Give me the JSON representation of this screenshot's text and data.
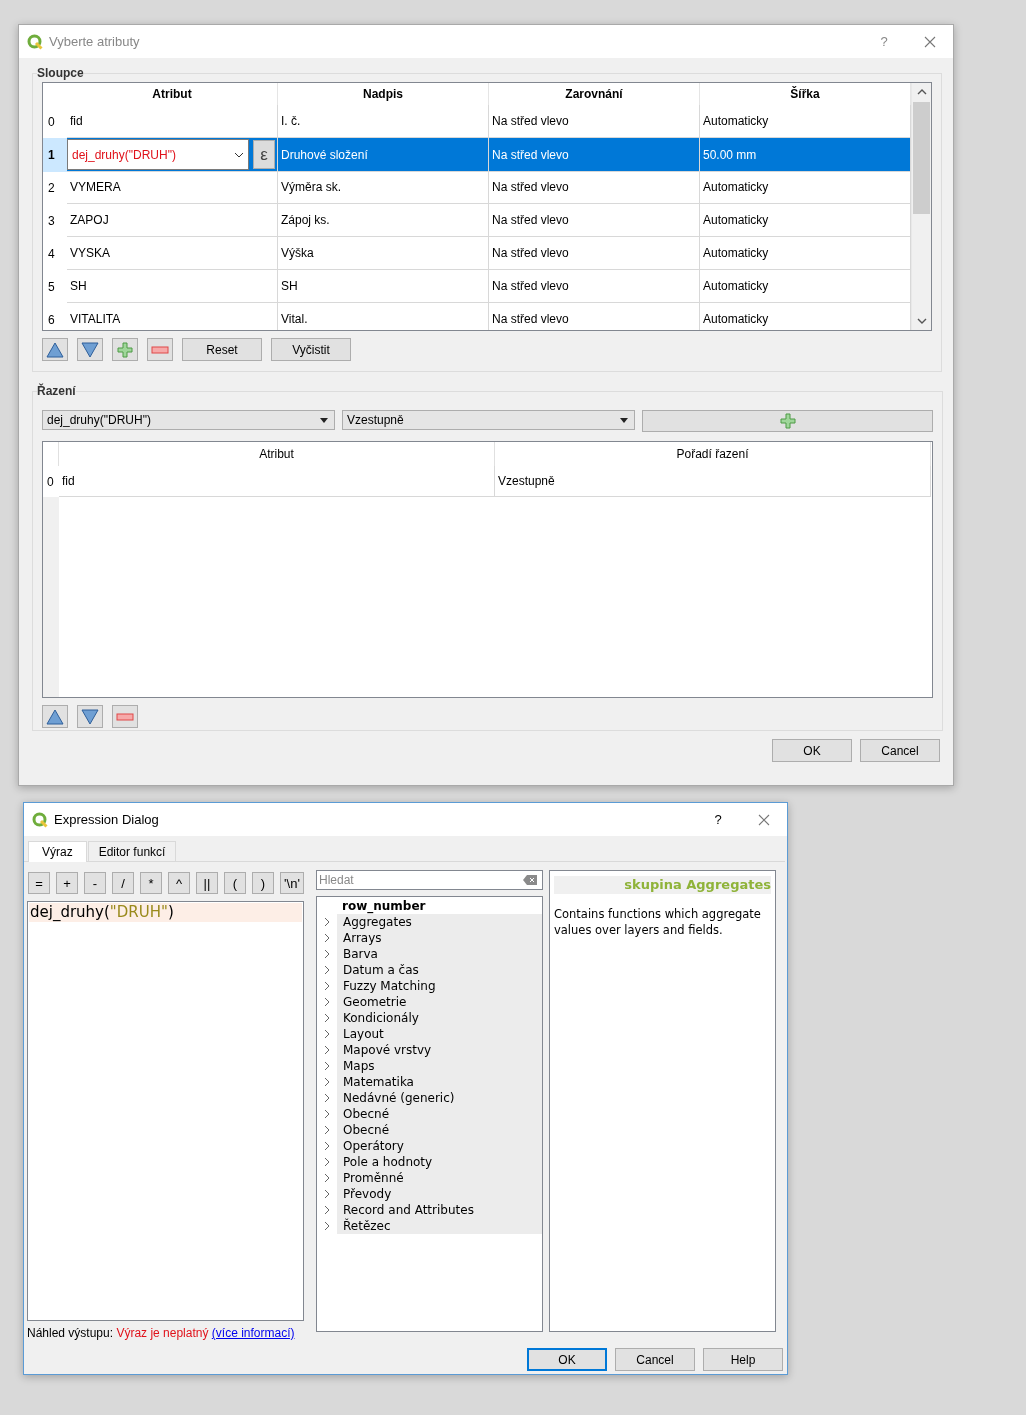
{
  "attribute_dialog": {
    "title": "Vyberte atributy",
    "help": "?",
    "columns_group": {
      "title": "Sloupce",
      "columns": [
        "Atribut",
        "Nadpis",
        "Zarovnání",
        "Šířka"
      ],
      "rows": [
        {
          "index": "0",
          "attribute": "fid",
          "heading": "I. č.",
          "alignment": "Na střed vlevo",
          "width": "Automaticky",
          "selected": false,
          "editing": false
        },
        {
          "index": "1",
          "attribute": "dej_druhy(\"DRUH\")",
          "heading": "Druhové složení",
          "alignment": "Na střed vlevo",
          "width": "50.00 mm",
          "selected": true,
          "editing": true,
          "expression_button": "ε"
        },
        {
          "index": "2",
          "attribute": "VYMERA",
          "heading": "Výměra sk.",
          "alignment": "Na střed vlevo",
          "width": "Automaticky",
          "selected": false,
          "editing": false
        },
        {
          "index": "3",
          "attribute": "ZAPOJ",
          "heading": "Zápoj ks.",
          "alignment": "Na střed vlevo",
          "width": "Automaticky",
          "selected": false,
          "editing": false
        },
        {
          "index": "4",
          "attribute": "VYSKA",
          "heading": "Výška",
          "alignment": "Na střed vlevo",
          "width": "Automaticky",
          "selected": false,
          "editing": false
        },
        {
          "index": "5",
          "attribute": "SH",
          "heading": "SH",
          "alignment": "Na střed vlevo",
          "width": "Automaticky",
          "selected": false,
          "editing": false
        },
        {
          "index": "6",
          "attribute": "VITALITA",
          "heading": "Vital.",
          "alignment": "Na střed vlevo",
          "width": "Automaticky",
          "selected": false,
          "editing": false
        }
      ],
      "buttons": [
        "Reset",
        "Vyčistit"
      ]
    },
    "sort_group": {
      "title": "Řazení",
      "attribute_combo": "dej_druhy(\"DRUH\")",
      "order_combo": "Vzestupně",
      "columns": [
        "Atribut",
        "Pořadí řazení"
      ],
      "rows": [
        {
          "index": "0",
          "attribute": "fid",
          "order": "Vzestupně"
        }
      ]
    },
    "buttons": [
      "OK",
      "Cancel"
    ]
  },
  "expression_dialog": {
    "title": "Expression Dialog",
    "help": "?",
    "tabs": [
      {
        "label": "Výraz",
        "selected": true
      },
      {
        "label": "Editor funkcí",
        "selected": false
      }
    ],
    "operators": [
      "=",
      "+",
      "-",
      "/",
      "*",
      "^",
      "||",
      "(",
      ")",
      "'\\n'"
    ],
    "expression": [
      {
        "kind": "plain",
        "text": "dej_druhy("
      },
      {
        "kind": "string",
        "text": "\"DRUH\""
      },
      {
        "kind": "plain",
        "text": ")"
      }
    ],
    "search": {
      "placeholder": "Hledat"
    },
    "function_list": [
      {
        "label": "row_number",
        "kind": "function"
      },
      {
        "label": "Aggregates",
        "kind": "group",
        "expanded": false
      },
      {
        "label": "Arrays",
        "kind": "group",
        "expanded": false
      },
      {
        "label": "Barva",
        "kind": "group",
        "expanded": false
      },
      {
        "label": "Datum a čas",
        "kind": "group",
        "expanded": false
      },
      {
        "label": "Fuzzy Matching",
        "kind": "group",
        "expanded": false
      },
      {
        "label": "Geometrie",
        "kind": "group",
        "expanded": false
      },
      {
        "label": "Kondicionály",
        "kind": "group",
        "expanded": false
      },
      {
        "label": "Layout",
        "kind": "group",
        "expanded": false
      },
      {
        "label": "Mapové vrstvy",
        "kind": "group",
        "expanded": false
      },
      {
        "label": "Maps",
        "kind": "group",
        "expanded": false
      },
      {
        "label": "Matematika",
        "kind": "group",
        "expanded": false
      },
      {
        "label": "Nedávné (generic)",
        "kind": "group",
        "expanded": false
      },
      {
        "label": "Obecné",
        "kind": "group",
        "expanded": false
      },
      {
        "label": "Obecné",
        "kind": "group",
        "expanded": false
      },
      {
        "label": "Operátory",
        "kind": "group",
        "expanded": false
      },
      {
        "label": "Pole a hodnoty",
        "kind": "group",
        "expanded": false
      },
      {
        "label": "Proměnné",
        "kind": "group",
        "expanded": false
      },
      {
        "label": "Převody",
        "kind": "group",
        "expanded": false
      },
      {
        "label": "Record and Attributes",
        "kind": "group",
        "expanded": false
      },
      {
        "label": "Řetězec",
        "kind": "group",
        "expanded": false
      }
    ],
    "help_panel": {
      "title": "skupina Aggregates",
      "text": "Contains functions which aggregate values over layers and fields."
    },
    "preview": {
      "label": "Náhled výstupu:",
      "value": "Výraz je neplatný",
      "link": "(více informací)"
    },
    "buttons": [
      {
        "label": "OK",
        "default": true
      },
      {
        "label": "Cancel",
        "default": false
      },
      {
        "label": "Help",
        "default": false
      }
    ]
  }
}
